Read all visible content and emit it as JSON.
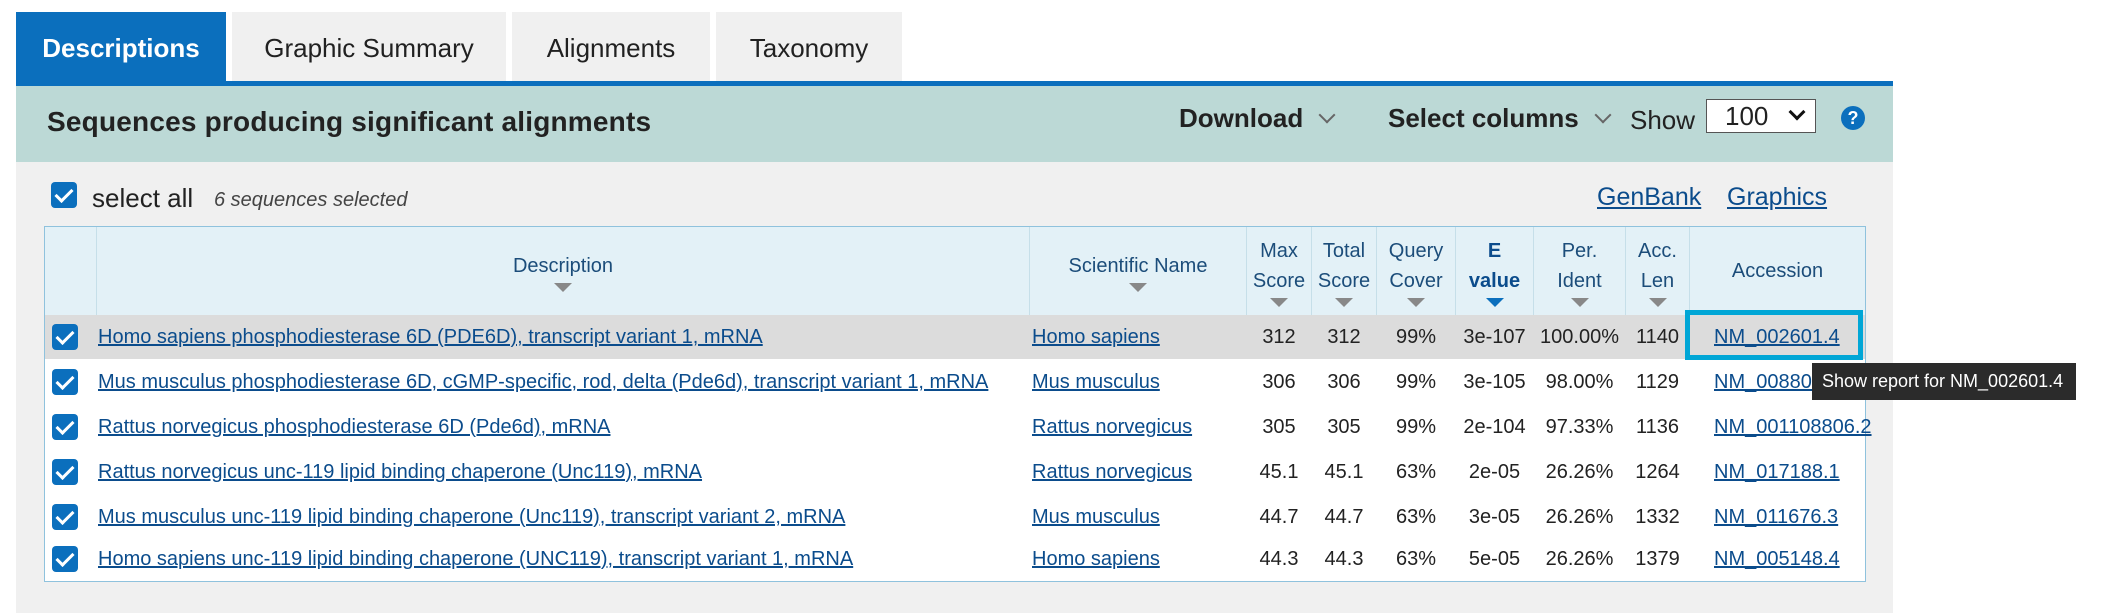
{
  "tabs": [
    {
      "label": "Descriptions",
      "active": true
    },
    {
      "label": "Graphic Summary",
      "active": false
    },
    {
      "label": "Alignments",
      "active": false
    },
    {
      "label": "Taxonomy",
      "active": false
    }
  ],
  "header": {
    "title": "Sequences producing significant alignments",
    "download_label": "Download",
    "select_columns_label": "Select columns",
    "show_label": "Show",
    "show_value": "100",
    "help_glyph": "?"
  },
  "selection": {
    "select_all_label": "select all",
    "count_text": "6 sequences selected",
    "genbank_link": "GenBank",
    "graphics_link": "Graphics"
  },
  "table": {
    "columns": [
      {
        "l1": "Description",
        "l2": ""
      },
      {
        "l1": "Scientific Name",
        "l2": ""
      },
      {
        "l1": "Max",
        "l2": "Score"
      },
      {
        "l1": "Total",
        "l2": "Score"
      },
      {
        "l1": "Query",
        "l2": "Cover"
      },
      {
        "l1": "E",
        "l2": "value"
      },
      {
        "l1": "Per.",
        "l2": "Ident"
      },
      {
        "l1": "Acc.",
        "l2": "Len"
      },
      {
        "l1": "Accession",
        "l2": ""
      }
    ],
    "rows": [
      {
        "description": "Homo sapiens phosphodiesterase 6D (PDE6D), transcript variant 1, mRNA",
        "sci_name": "Homo sapiens",
        "max_score": "312",
        "total_score": "312",
        "query_cover": "99%",
        "e_value": "3e-107",
        "per_ident": "100.00%",
        "acc_len": "1140",
        "accession": "NM_002601.4"
      },
      {
        "description": "Mus musculus phosphodiesterase 6D, cGMP-specific, rod, delta (Pde6d), transcript variant 1, mRNA",
        "sci_name": "Mus musculus",
        "max_score": "306",
        "total_score": "306",
        "query_cover": "99%",
        "e_value": "3e-105",
        "per_ident": "98.00%",
        "acc_len": "1129",
        "accession": "NM_008801."
      },
      {
        "description": "Rattus norvegicus phosphodiesterase 6D (Pde6d), mRNA",
        "sci_name": "Rattus norvegicus",
        "max_score": "305",
        "total_score": "305",
        "query_cover": "99%",
        "e_value": "2e-104",
        "per_ident": "97.33%",
        "acc_len": "1136",
        "accession": "NM_001108806.2"
      },
      {
        "description": "Rattus norvegicus unc-119 lipid binding chaperone (Unc119), mRNA",
        "sci_name": "Rattus norvegicus",
        "max_score": "45.1",
        "total_score": "45.1",
        "query_cover": "63%",
        "e_value": "2e-05",
        "per_ident": "26.26%",
        "acc_len": "1264",
        "accession": "NM_017188.1"
      },
      {
        "description": "Mus musculus unc-119 lipid binding chaperone (Unc119), transcript variant 2, mRNA",
        "sci_name": "Mus musculus",
        "max_score": "44.7",
        "total_score": "44.7",
        "query_cover": "63%",
        "e_value": "3e-05",
        "per_ident": "26.26%",
        "acc_len": "1332",
        "accession": "NM_011676.3"
      },
      {
        "description": "Homo sapiens unc-119 lipid binding chaperone (UNC119), transcript variant 1, mRNA",
        "sci_name": "Homo sapiens",
        "max_score": "44.3",
        "total_score": "44.3",
        "query_cover": "63%",
        "e_value": "5e-05",
        "per_ident": "26.26%",
        "acc_len": "1379",
        "accession": "NM_005148.4"
      }
    ]
  },
  "tooltip": {
    "text": "Show report for NM_002601.4"
  },
  "colors": {
    "accent": "#0b6fbd",
    "header_bar": "#bcd9d6",
    "focus": "#00a6d6"
  }
}
